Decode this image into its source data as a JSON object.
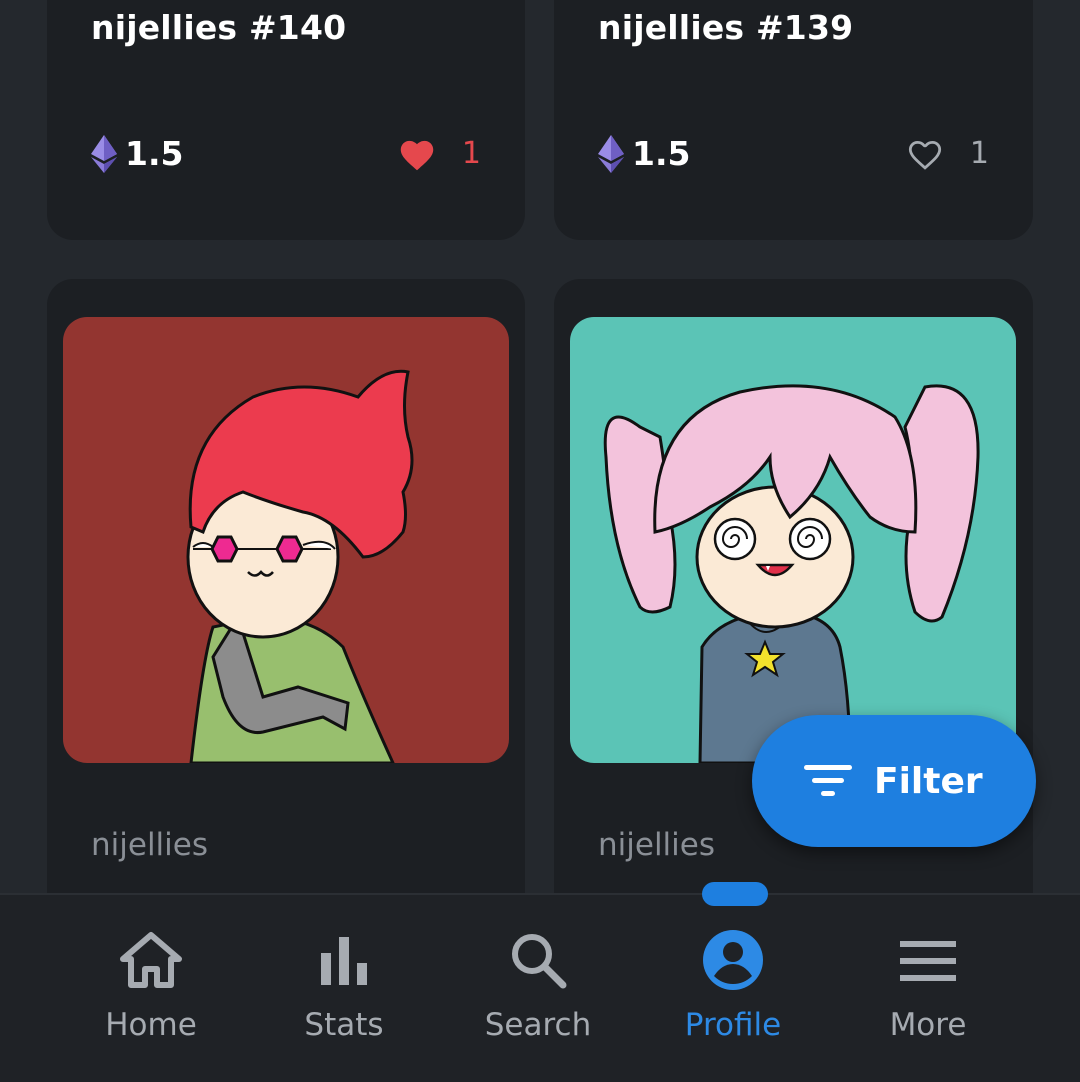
{
  "cards": [
    {
      "title": "nijellies #140",
      "price": "1.5",
      "likes": "1",
      "liked": true
    },
    {
      "title": "nijellies #139",
      "price": "1.5",
      "likes": "1",
      "liked": false
    },
    {
      "collection": "nijellies",
      "bg": "#933530"
    },
    {
      "collection": "nijellies",
      "bg": "#5bc4b6"
    }
  ],
  "filter": {
    "label": "Filter",
    "icon": "filter-icon"
  },
  "nav": [
    {
      "label": "Home",
      "icon": "home-icon",
      "active": false
    },
    {
      "label": "Stats",
      "icon": "bar-chart-icon",
      "active": false
    },
    {
      "label": "Search",
      "icon": "search-icon",
      "active": false
    },
    {
      "label": "Profile",
      "icon": "account-circle-icon",
      "active": true
    },
    {
      "label": "More",
      "icon": "menu-icon",
      "active": false
    }
  ],
  "colors": {
    "accent": "#1e7fe0",
    "liked": "#e5484d",
    "eth": "#8a7bd8"
  }
}
